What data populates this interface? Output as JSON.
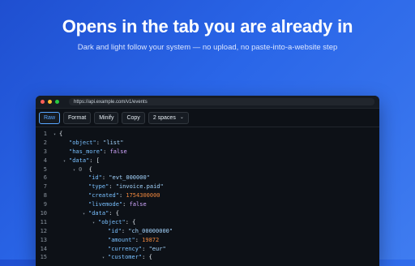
{
  "hero": {
    "title": "Opens in the tab you are already in",
    "subtitle": "Dark and light follow your system — no upload, no paste-into-a-website step"
  },
  "browser": {
    "url": "https://api.example.com/v1/events"
  },
  "toolbar": {
    "raw": "Raw",
    "format": "Format",
    "minify": "Minify",
    "copy": "Copy",
    "indent": "2 spaces"
  },
  "code_lines": [
    {
      "n": "1",
      "ind": 0,
      "toggle": true,
      "parts": [
        {
          "t": "{",
          "c": "p"
        }
      ]
    },
    {
      "n": "2",
      "ind": 1,
      "toggle": false,
      "parts": [
        {
          "t": "\"object\"",
          "c": "k"
        },
        {
          "t": ": ",
          "c": "p"
        },
        {
          "t": "\"list\"",
          "c": "s"
        }
      ]
    },
    {
      "n": "3",
      "ind": 1,
      "toggle": false,
      "parts": [
        {
          "t": "\"has_more\"",
          "c": "k"
        },
        {
          "t": ": ",
          "c": "p"
        },
        {
          "t": "false",
          "c": "b"
        }
      ]
    },
    {
      "n": "4",
      "ind": 1,
      "toggle": true,
      "parts": [
        {
          "t": "\"data\"",
          "c": "k"
        },
        {
          "t": ": [",
          "c": "p"
        }
      ]
    },
    {
      "n": "5",
      "ind": 2,
      "toggle": true,
      "parts": [
        {
          "t": "0",
          "c": "indexkey"
        },
        {
          "t": "  {",
          "c": "p"
        }
      ]
    },
    {
      "n": "6",
      "ind": 3,
      "toggle": false,
      "parts": [
        {
          "t": "\"id\"",
          "c": "k"
        },
        {
          "t": ": ",
          "c": "p"
        },
        {
          "t": "\"evt_000000\"",
          "c": "s"
        }
      ]
    },
    {
      "n": "7",
      "ind": 3,
      "toggle": false,
      "parts": [
        {
          "t": "\"type\"",
          "c": "k"
        },
        {
          "t": ": ",
          "c": "p"
        },
        {
          "t": "\"invoice.paid\"",
          "c": "s"
        }
      ]
    },
    {
      "n": "8",
      "ind": 3,
      "toggle": false,
      "parts": [
        {
          "t": "\"created\"",
          "c": "k"
        },
        {
          "t": ": ",
          "c": "p"
        },
        {
          "t": "1754300000",
          "c": "n"
        }
      ]
    },
    {
      "n": "9",
      "ind": 3,
      "toggle": false,
      "parts": [
        {
          "t": "\"livemode\"",
          "c": "k"
        },
        {
          "t": ": ",
          "c": "p"
        },
        {
          "t": "false",
          "c": "b"
        }
      ]
    },
    {
      "n": "10",
      "ind": 3,
      "toggle": true,
      "parts": [
        {
          "t": "\"data\"",
          "c": "k"
        },
        {
          "t": ": {",
          "c": "p"
        }
      ]
    },
    {
      "n": "11",
      "ind": 4,
      "toggle": true,
      "parts": [
        {
          "t": "\"object\"",
          "c": "k"
        },
        {
          "t": ": {",
          "c": "p"
        }
      ]
    },
    {
      "n": "12",
      "ind": 5,
      "toggle": false,
      "parts": [
        {
          "t": "\"id\"",
          "c": "k"
        },
        {
          "t": ": ",
          "c": "p"
        },
        {
          "t": "\"ch_00000000\"",
          "c": "s"
        }
      ]
    },
    {
      "n": "13",
      "ind": 5,
      "toggle": false,
      "parts": [
        {
          "t": "\"amount\"",
          "c": "k"
        },
        {
          "t": ": ",
          "c": "p"
        },
        {
          "t": "19872",
          "c": "n"
        }
      ]
    },
    {
      "n": "14",
      "ind": 5,
      "toggle": false,
      "parts": [
        {
          "t": "\"currency\"",
          "c": "k"
        },
        {
          "t": ": ",
          "c": "p"
        },
        {
          "t": "\"eur\"",
          "c": "s"
        }
      ]
    },
    {
      "n": "15",
      "ind": 5,
      "toggle": true,
      "parts": [
        {
          "t": "\"customer\"",
          "c": "k"
        },
        {
          "t": ": {",
          "c": "p"
        }
      ]
    }
  ]
}
